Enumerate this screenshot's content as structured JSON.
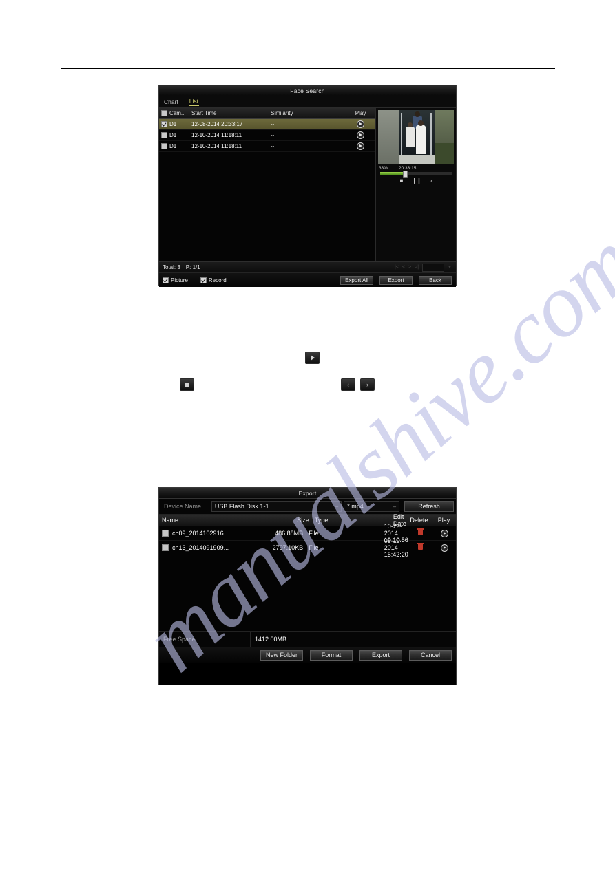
{
  "page": {
    "watermark": "manualshive.com"
  },
  "face_search": {
    "title": "Face Search",
    "tabs": [
      {
        "label": "Chart",
        "active": false
      },
      {
        "label": "List",
        "active": true
      }
    ],
    "columns": {
      "camera": "Cam...",
      "start_time": "Start Time",
      "similarity": "Similarity",
      "play": "Play"
    },
    "rows": [
      {
        "checked": true,
        "camera": "D1",
        "start_time": "12-08-2014 20:33:17",
        "similarity": "--"
      },
      {
        "checked": false,
        "camera": "D1",
        "start_time": "12-10-2014 11:18:11",
        "similarity": "--"
      },
      {
        "checked": false,
        "camera": "D1",
        "start_time": "12-10-2014 11:18:11",
        "similarity": "--"
      }
    ],
    "preview": {
      "progress_percent": "33%",
      "timestamp": "20:33:15",
      "progress_value": 33,
      "controls": {
        "stop": "stop-icon",
        "pause": "pause-icon",
        "next": "next-frame-icon"
      }
    },
    "status": {
      "total": "Total: 3",
      "page": "P: 1/1"
    },
    "pager": {
      "first": "|<",
      "prev": "<",
      "next": ">",
      "last": ">|",
      "goto_value": ""
    },
    "options": [
      {
        "label": "Picture",
        "checked": true
      },
      {
        "label": "Record",
        "checked": true
      }
    ],
    "buttons": {
      "export_all": "Export All",
      "export": "Export",
      "back": "Back"
    }
  },
  "inline_buttons": {
    "play": "play-icon",
    "stop": "stop-icon",
    "prev": "‹",
    "next": "›"
  },
  "export_dialog": {
    "title": "Export",
    "device_label": "Device Name",
    "device_value": "USB Flash Disk 1-1",
    "filetype_value": "*.mp4",
    "refresh_label": "Refresh",
    "columns": {
      "name": "Name",
      "size": "Size",
      "type": "Type",
      "edit_date": "Edit Date",
      "delete": "Delete",
      "play": "Play"
    },
    "rows": [
      {
        "checked": false,
        "name": "ch09_2014102916...",
        "size": "486.88MB",
        "type": "File",
        "edit_date": "10-29-2014 19:10:56"
      },
      {
        "checked": false,
        "name": "ch13_2014091909...",
        "size": "2707.10KB",
        "type": "File",
        "edit_date": "09-19-2014 15:42:20"
      }
    ],
    "free_space_label": "Free Space",
    "free_space_value": "1412.00MB",
    "buttons": {
      "new_folder": "New Folder",
      "format": "Format",
      "export": "Export",
      "cancel": "Cancel"
    }
  },
  "colors": {
    "accent_tab": "#c9c86a",
    "selected_row": "#6d6a3c",
    "delete_red": "#c0392b",
    "progress_green": "#7fbf2e",
    "watermark": "#b9bce4"
  }
}
